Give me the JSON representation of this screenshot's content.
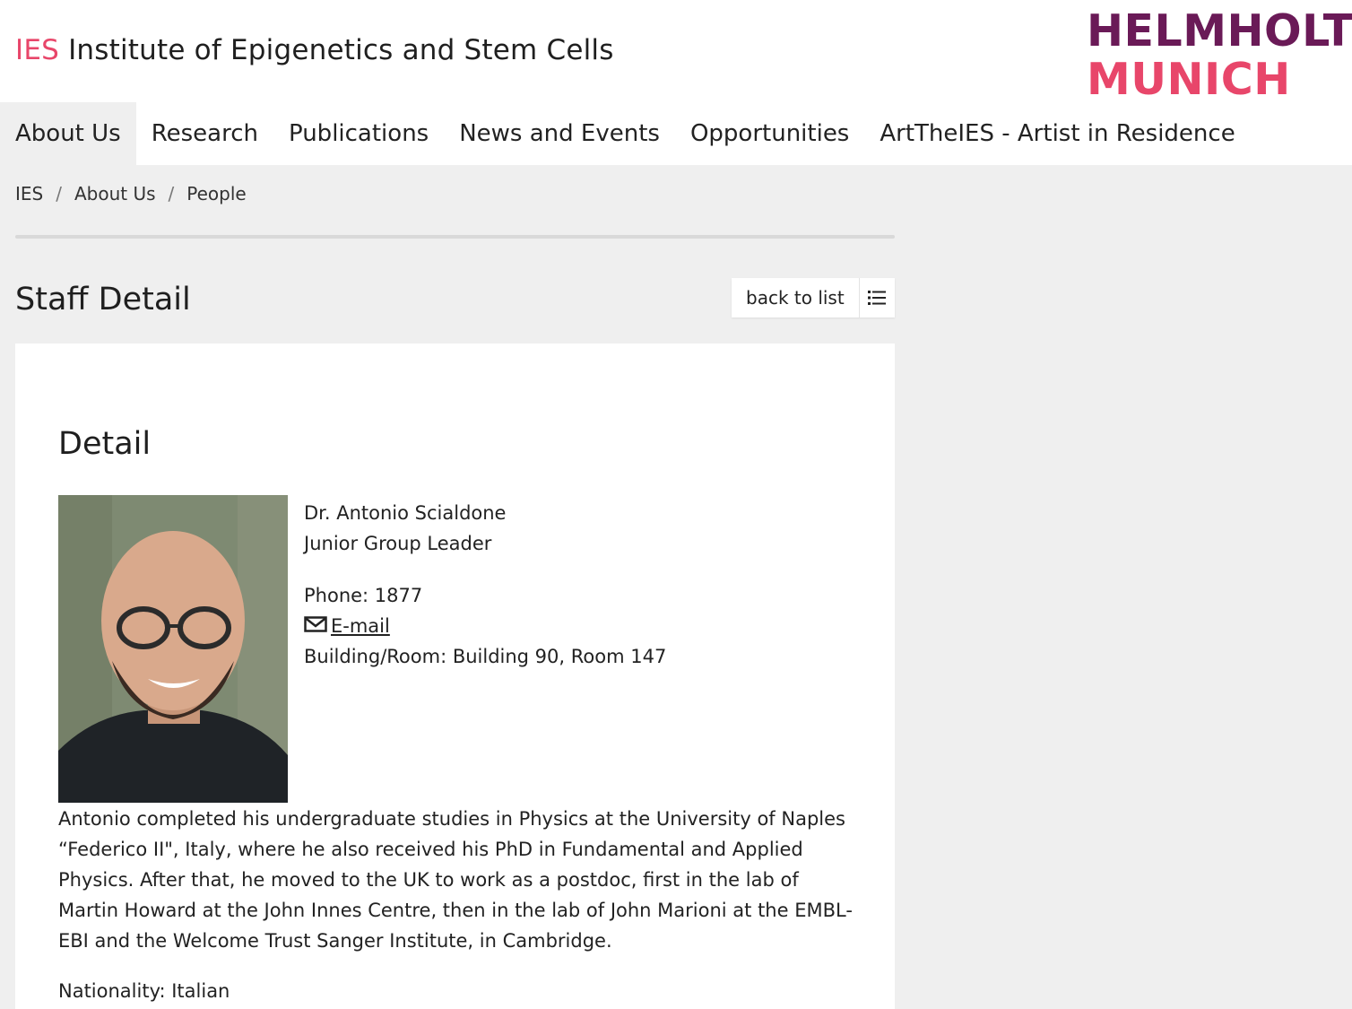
{
  "site": {
    "abbr": "IES",
    "title": "Institute of Epigenetics and Stem Cells",
    "logo_line1": "HELMHOLTZ",
    "logo_line2": "MUNICH",
    "brand_pink": "#e8466a",
    "brand_purple": "#6a1a57"
  },
  "nav": {
    "items": [
      {
        "label": "About Us",
        "active": true
      },
      {
        "label": "Research"
      },
      {
        "label": "Publications"
      },
      {
        "label": "News and Events"
      },
      {
        "label": "Opportunities"
      },
      {
        "label": "ArtTheIES - Artist in Residence"
      }
    ]
  },
  "breadcrumb": {
    "items": [
      "IES",
      "About Us",
      "People"
    ],
    "separator": "/"
  },
  "page": {
    "title": "Staff Detail",
    "back_label": "back to list",
    "back_icon": "list-icon"
  },
  "detail": {
    "heading": "Detail",
    "name": "Dr. Antonio Scialdone",
    "position": "Junior Group Leader",
    "phone": "Phone: 1877",
    "email_label": "E-mail",
    "email_icon": "mail-icon",
    "room": "Building/Room: Building 90, Room 147",
    "bio": "Antonio completed his undergraduate studies in Physics at the University of Naples “Federico II\", Italy, where he also received his PhD in Fundamental and Applied Physics. After that, he moved to the UK to work as a postdoc, first in the lab of Martin Howard at the John Innes Centre, then in the lab of John Marioni at the EMBL-EBI and the Welcome Trust Sanger Institute, in Cambridge.",
    "nationality": "Nationality: Italian"
  }
}
